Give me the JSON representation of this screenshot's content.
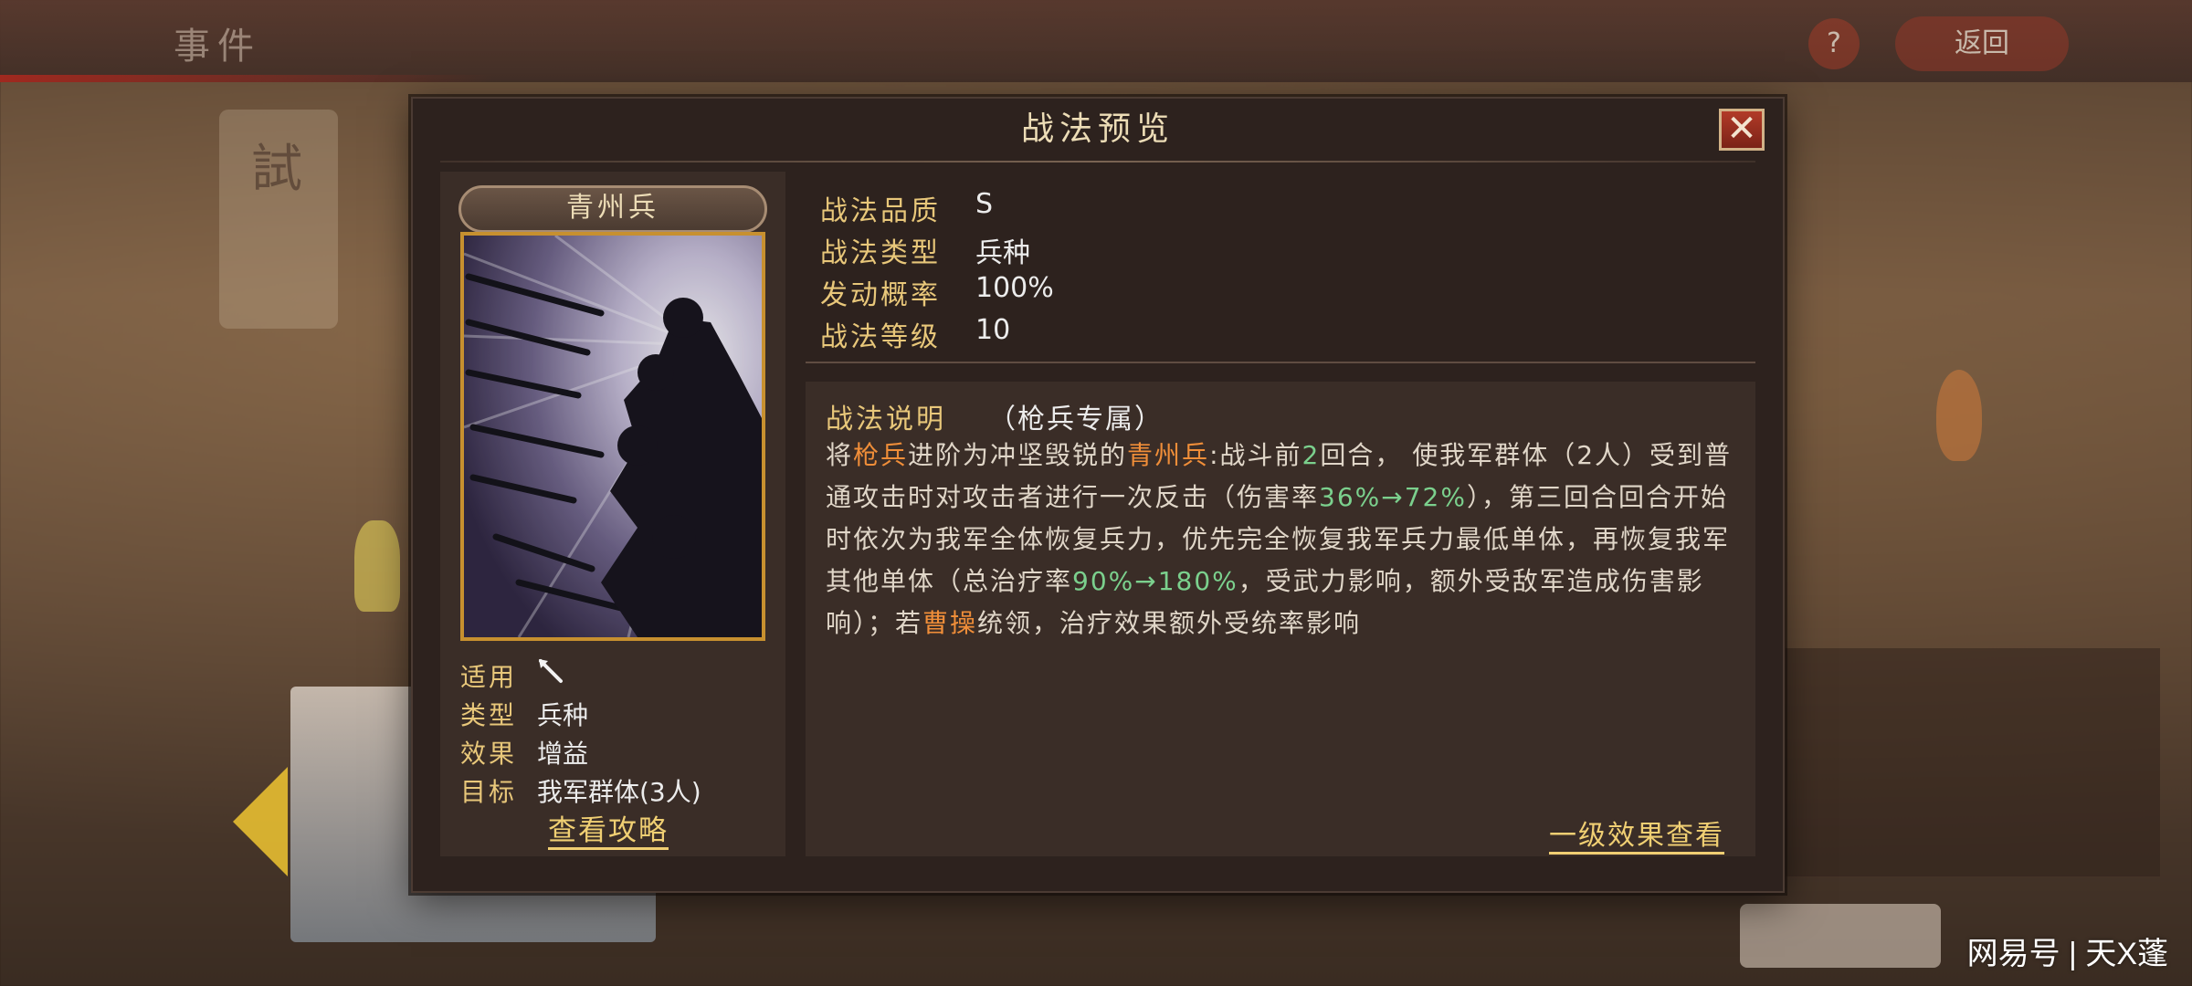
{
  "background": {
    "top_title": "事件",
    "help_symbol": "?",
    "return_label": "返回",
    "banner_char": "試"
  },
  "dialog": {
    "title": "战法预览",
    "close_symbol": "✕"
  },
  "skill": {
    "name": "青州兵",
    "applicable_label": "适用",
    "applicable_icon": "spear-icon",
    "type_label": "类型",
    "type_value": "兵种",
    "effect_label": "效果",
    "effect_value": "增益",
    "target_label": "目标",
    "target_value": "我军群体(3人)",
    "guide_link": "查看攻略"
  },
  "meta": {
    "quality_label": "战法品质",
    "quality_value": "S",
    "kind_label": "战法类型",
    "kind_value": "兵种",
    "chance_label": "发动概率",
    "chance_value": "100%",
    "level_label": "战法等级",
    "level_value": "10"
  },
  "description": {
    "heading": "战法说明",
    "note": "（枪兵专属）",
    "seg1": "将",
    "seg2": "枪兵",
    "seg3": "进阶为冲坚毁锐的",
    "seg4": "青州兵",
    "seg5": ":战斗前",
    "seg6": "2",
    "seg7": "回合， 使我军群体（2人）受到普通攻击时对攻击者进行一次反击（伤害率",
    "seg8": "36%→72%",
    "seg9": "），第三回合回合开始时依次为我军全体恢复兵力，优先完全恢复我军兵力最低单体，再恢复我军其他单体（总治疗率",
    "seg10": "90%→180%",
    "seg11": "，受武力影响，额外受敌军造成伤害影响）；若",
    "seg12": "曹操",
    "seg13": "统领，治疗效果额外受统率影响",
    "level_effect_link": "一级效果查看"
  },
  "watermark": "网易号 | 天X蓬",
  "colors": {
    "accent_gold": "#e8c77a",
    "highlight_orange": "#f08e39",
    "highlight_green": "#7bd08d",
    "close_red": "#b23b28",
    "portrait_border": "#c7902f"
  }
}
